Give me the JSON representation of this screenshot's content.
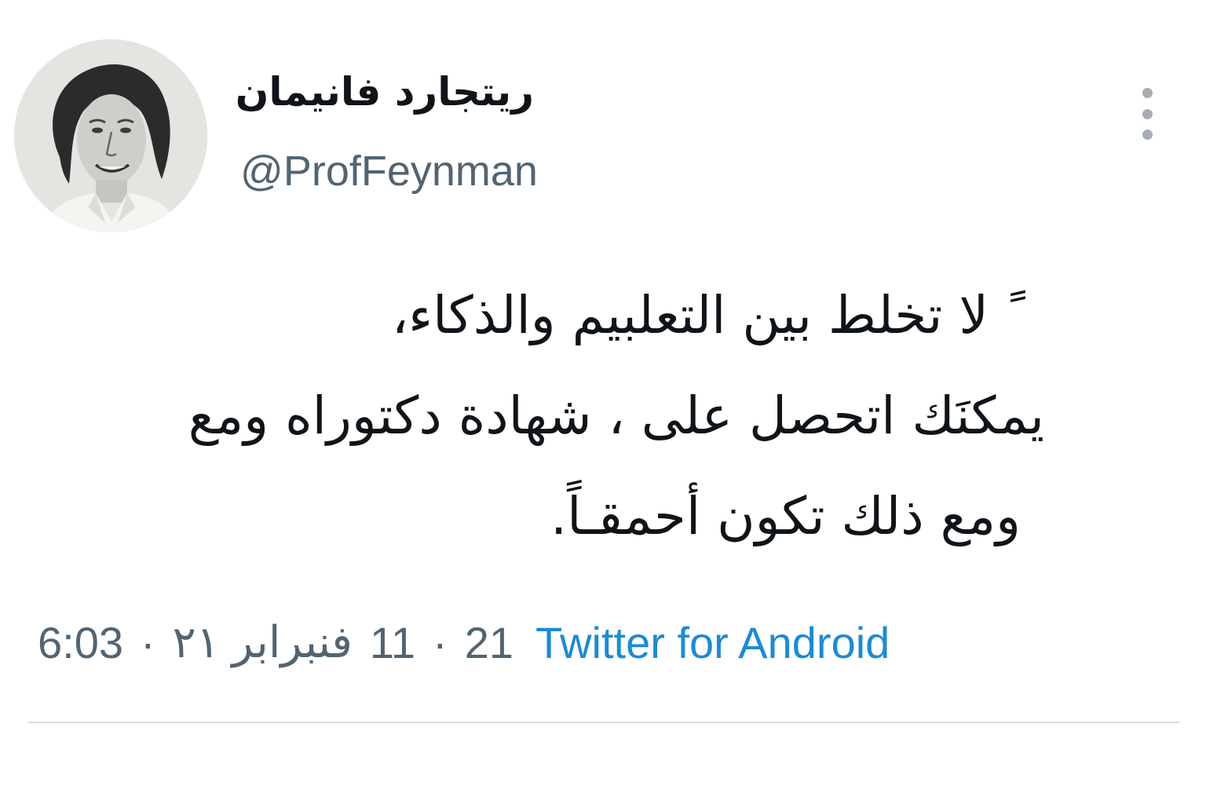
{
  "user": {
    "display_name": "ريتجارد فانيمان",
    "handle": "@ProfFeynman",
    "avatar_icon": "profile-photo"
  },
  "tweet": {
    "lines": [
      "ً لا تخلط  بين التعلبيم والذكاء،",
      "يمكنَك اتحصل على ، شهادة دكتوراه ومع",
      "ومع ذلك تكون أحمقـاً."
    ]
  },
  "meta": {
    "time": "6:03",
    "separator": "·",
    "date": "فنبرابر ٢١",
    "day_number": "11",
    "year": "21",
    "source": "Twitter for Android"
  },
  "colors": {
    "text": "#0f1419",
    "secondary": "#536471",
    "link": "#1d8bd1",
    "divider": "#d9dde0"
  }
}
